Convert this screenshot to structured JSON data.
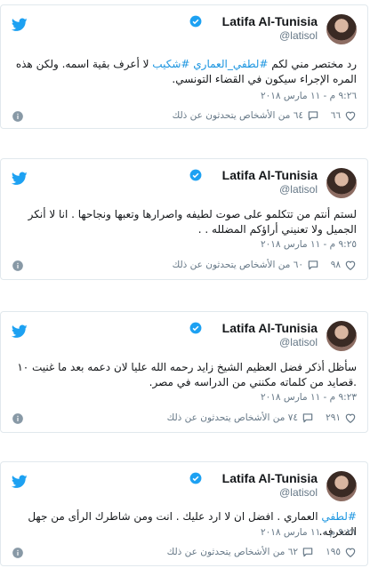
{
  "tweets": [
    {
      "name": "Latifa Al-Tunisia",
      "handle": "@latisol",
      "text_parts": [
        {
          "t": "رد مختصر مني لكم "
        },
        {
          "t": "#لطفي_العماري",
          "tag": true
        },
        {
          "t": " "
        },
        {
          "t": "#شكيب",
          "tag": true
        },
        {
          "t": " لا أعرف بقية اسمه. ولكن هذه المره الإجراء سيكون في القضاء التونسي."
        }
      ],
      "time": "٩:٢٦ م - ١١ مارس ٢٠١٨",
      "likes": "٦٦",
      "replies": "٦٤ من الأشخاص يتحدثون عن ذلك"
    },
    {
      "name": "Latifa Al-Tunisia",
      "handle": "@latisol",
      "text_parts": [
        {
          "t": "لستم أنتم من تتكلمو على صوت لطيفه واصرارها وتعبها ونجاحها . انا لا أنكر الجميل ولا تعنيني أراؤكم المضلله . ."
        }
      ],
      "time": "٩:٢٥ م - ١١ مارس ٢٠١٨",
      "likes": "٩٨",
      "replies": "٦٠ من الأشخاص يتحدثون عن ذلك"
    },
    {
      "name": "Latifa Al-Tunisia",
      "handle": "@latisol",
      "text_parts": [
        {
          "t": "سأظل أذكر فضل العظيم الشيخ زايد رحمه الله عليا لان دعمه بعد ما غنيت ١٠ .قصايد من كلماته مكنني من الدراسه في مصر."
        }
      ],
      "time": "٩:٢٣ م - ١١ مارس ٢٠١٨",
      "likes": "٢٩١",
      "replies": "٧٤ من الأشخاص يتحدثون عن ذلك"
    },
    {
      "name": "Latifa Al-Tunisia",
      "handle": "@latisol",
      "text_parts": [
        {
          "t": "#لطفي",
          "tag": true
        },
        {
          "t": " العماري . افضل ان لا ارد عليك . انت ومن شاطرك الرأى من جهل المعرفه."
        }
      ],
      "time": "٩:٢١ م - ١١ مارس ٢٠١٨",
      "likes": "١٩٥",
      "replies": "٦٢ من الأشخاص يتحدثون عن ذلك"
    }
  ],
  "colors": {
    "brand": "#1da1f2",
    "link": "#1b95e0",
    "muted": "#657786",
    "border": "#e1e8ed"
  },
  "icons": [
    "twitter-bird-icon",
    "verified-badge-icon",
    "heart-icon",
    "reply-bubble-icon",
    "info-icon"
  ]
}
